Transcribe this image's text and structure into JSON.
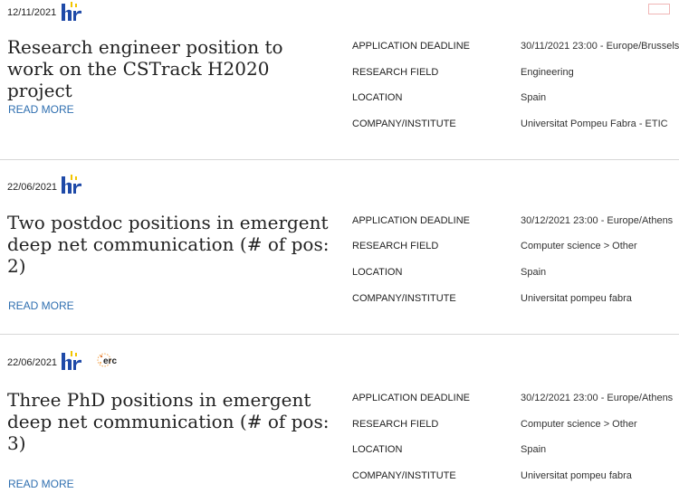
{
  "labels": {
    "deadline": "Application Deadline",
    "field": "Research Field",
    "location": "Location",
    "company": "Company/Institute",
    "read_more": "READ MORE"
  },
  "jobs": [
    {
      "date": "12/11/2021",
      "title": "Research engineer position to work on the CSTrack H2020 project",
      "deadline": "30/11/2021 23:00 - Europe/Brussels",
      "field": "Engineering",
      "location": "Spain",
      "company": "Universitat Pompeu Fabra - ETIC"
    },
    {
      "date": "22/06/2021",
      "title": "Two postdoc positions in emergent deep net communication (# of pos: 2)",
      "deadline": "30/12/2021 23:00 - Europe/Athens",
      "field": "Computer science > Other",
      "location": "Spain",
      "company": "Universitat pompeu fabra"
    },
    {
      "date": "22/06/2021",
      "title": "Three PhD positions in emergent deep net communication (# of pos: 3)",
      "deadline": "30/12/2021 23:00 - Europe/Athens",
      "field": "Computer science > Other",
      "location": "Spain",
      "company": "Universitat pompeu fabra"
    }
  ],
  "logos": {
    "hr_icon": "hr-excellence-in-research-logo",
    "erc_icon": "erc-logo",
    "erc_text": "erc"
  },
  "colors": {
    "link": "#2f6fb0",
    "hr_blue": "#1f4aa8",
    "hr_yellow": "#f2c500"
  }
}
